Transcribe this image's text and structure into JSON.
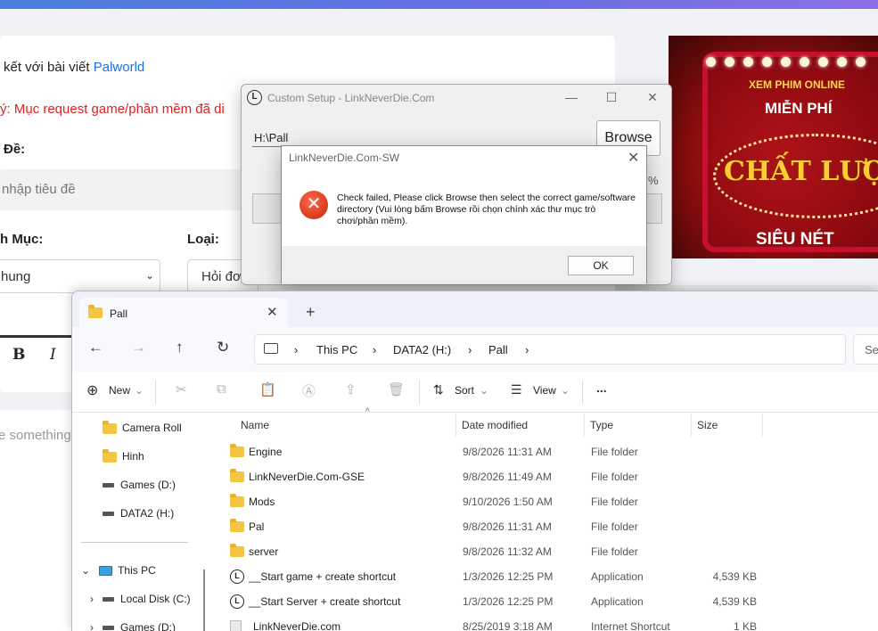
{
  "web": {
    "link_prefix": "kết với bài viết",
    "link_text": "Palworld",
    "note": "ý: Mục request game/phần mềm đã di",
    "title_label": "Đề:",
    "title_placeholder": "nhập tiêu đề",
    "category_label": "h Mục:",
    "category_value": "hung",
    "type_label": "Loại:",
    "type_value": "Hỏi đơ",
    "editor_bold": "B",
    "editor_italic": "I",
    "editor_placeholder": "e something"
  },
  "ad": {
    "line1": "XEM PHIM ONLINE",
    "line2": "MIỄN PHÍ",
    "line3": "CHẤT LƯỢNG",
    "line4": "SIÊU NÉT"
  },
  "setup": {
    "title": "Custom Setup  - LinkNeverDie.Com",
    "app_icon_letter": "L",
    "path_value": "H:\\Pall",
    "browse_label": "Browse",
    "percent": "%"
  },
  "error_dialog": {
    "title": "LinkNeverDie.Com-SW",
    "message": "Check failed, Please click Browse then select the correct game/software directory (Vui lòng bấm Browse rồi chọn chính xác thư mục trò chơi/phần mềm).",
    "ok_label": "OK",
    "icon": "error-icon"
  },
  "explorer": {
    "tab_title": "Pall",
    "breadcrumb": [
      "This PC",
      "DATA2 (H:)",
      "Pall"
    ],
    "search_placeholder": "Se",
    "commands": {
      "new": "New",
      "sort": "Sort",
      "view": "View",
      "more": "..."
    },
    "sidebar": [
      {
        "label": "Camera Roll",
        "icon": "folder-icon"
      },
      {
        "label": "Hinh",
        "icon": "folder-icon"
      },
      {
        "label": "Games (D:)",
        "icon": "drive-icon"
      },
      {
        "label": "DATA2 (H:)",
        "icon": "drive-icon"
      },
      {
        "label": "This PC",
        "icon": "pc-icon"
      },
      {
        "label": "Local Disk (C:)",
        "icon": "drive-icon"
      },
      {
        "label": "Games (D:)",
        "icon": "drive-icon"
      }
    ],
    "columns": [
      "Name",
      "Date modified",
      "Type",
      "Size"
    ],
    "files": [
      {
        "name": "Engine",
        "date": "9/8/2026 11:31 AM",
        "type": "File folder",
        "size": ""
      },
      {
        "name": "LinkNeverDie.Com-GSE",
        "date": "9/8/2026 11:49 AM",
        "type": "File folder",
        "size": ""
      },
      {
        "name": "Mods",
        "date": "9/10/2026 1:50 AM",
        "type": "File folder",
        "size": ""
      },
      {
        "name": "Pal",
        "date": "9/8/2026 11:31 AM",
        "type": "File folder",
        "size": ""
      },
      {
        "name": "server",
        "date": "9/8/2026 11:32 AM",
        "type": "File folder",
        "size": ""
      },
      {
        "name": "__Start game + create shortcut",
        "date": "1/3/2026 12:25 PM",
        "type": "Application",
        "size": "4,539 KB"
      },
      {
        "name": "__Start Server + create shortcut",
        "date": "1/3/2026 12:25 PM",
        "type": "Application",
        "size": "4,539 KB"
      },
      {
        "name": "LinkNeverDie.com",
        "date": "8/25/2019 3:18 AM",
        "type": "Internet Shortcut",
        "size": "1 KB"
      }
    ]
  }
}
